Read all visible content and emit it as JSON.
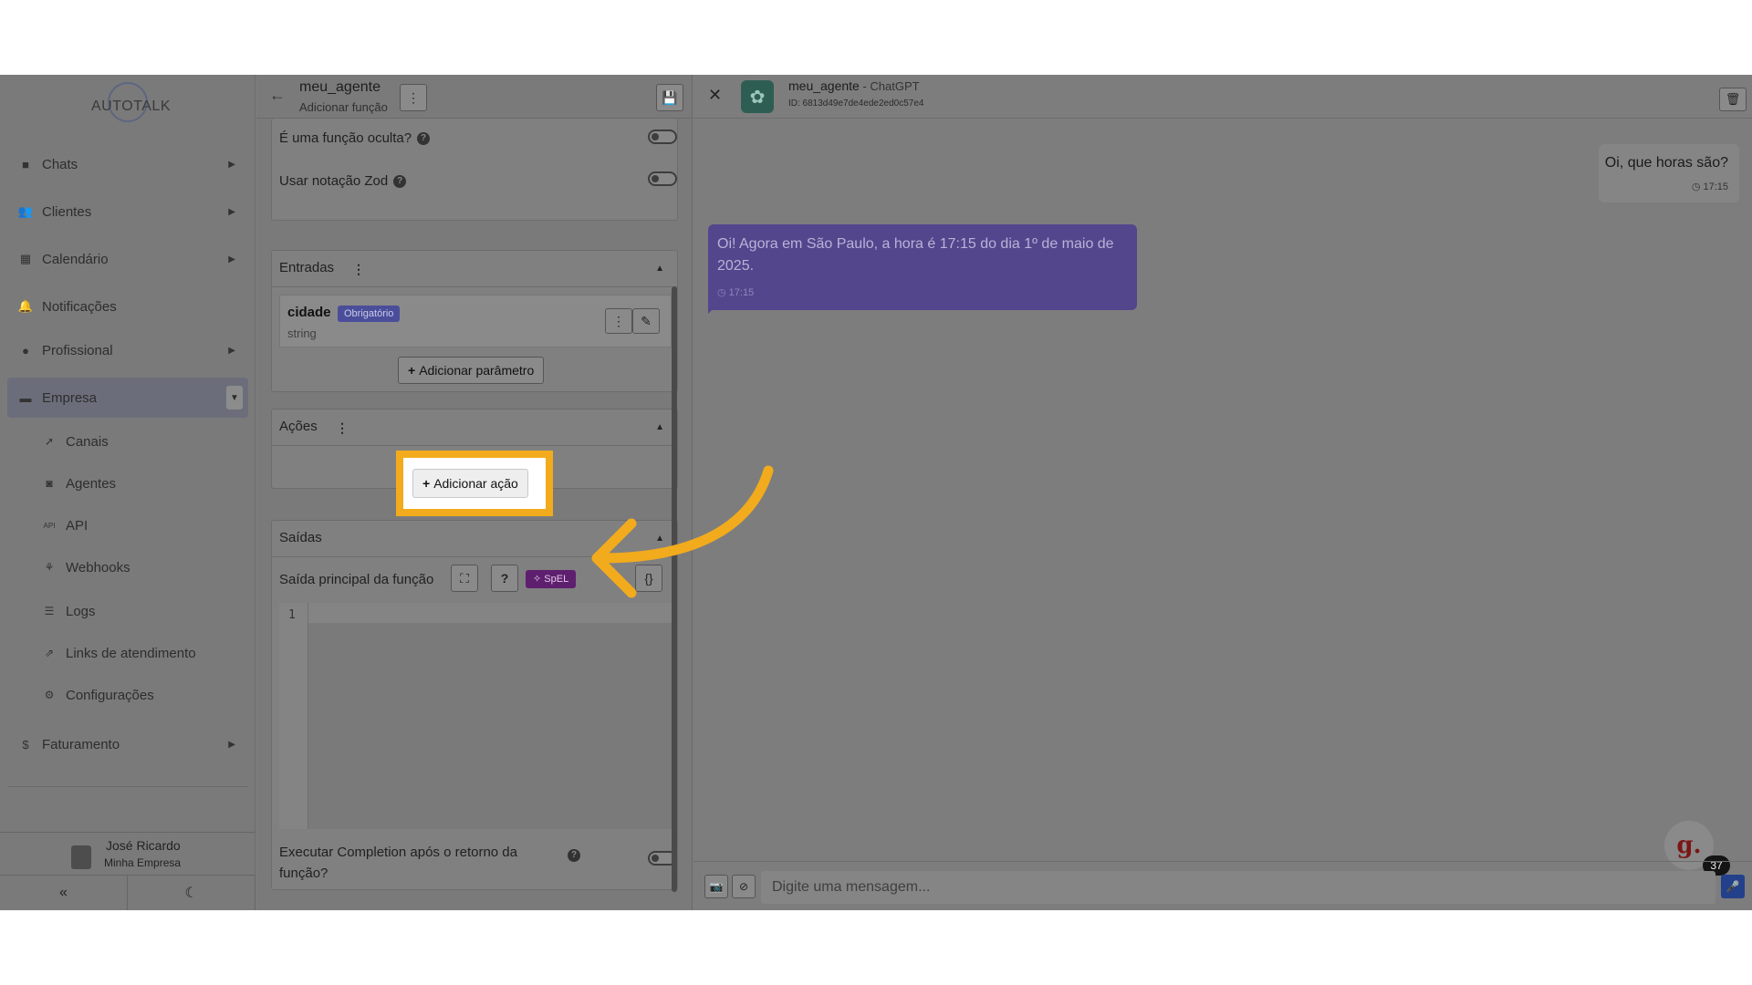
{
  "sidebar": {
    "logo": "AUTOTALK",
    "nav": [
      {
        "label": "Chats",
        "icon": "chat-icon"
      },
      {
        "label": "Clientes",
        "icon": "users-icon"
      },
      {
        "label": "Calendário",
        "icon": "calendar-icon"
      },
      {
        "label": "Notificações",
        "icon": "bell-icon"
      },
      {
        "label": "Profissional",
        "icon": "user-tie-icon"
      },
      {
        "label": "Empresa",
        "icon": "building-icon"
      }
    ],
    "sub": [
      {
        "label": "Canais",
        "icon": "rocket-icon"
      },
      {
        "label": "Agentes",
        "icon": "robot-icon"
      },
      {
        "label": "API",
        "icon": "api-icon"
      },
      {
        "label": "Webhooks",
        "icon": "webhook-icon"
      },
      {
        "label": "Logs",
        "icon": "list-icon"
      },
      {
        "label": "Links de atendimento",
        "icon": "external-link-icon"
      },
      {
        "label": "Configurações",
        "icon": "gear-icon"
      }
    ],
    "billing": {
      "label": "Faturamento",
      "icon": "dollar-icon"
    },
    "user": {
      "name": "José Ricardo",
      "company": "Minha Empresa"
    }
  },
  "editor": {
    "title": "meu_agente",
    "subtitle": "Adicionar função",
    "hidden_label": "É uma função oculta?",
    "zod_label": "Usar notação Zod",
    "inputs": {
      "title": "Entradas",
      "param": {
        "name": "cidade",
        "badge": "Obrigatório",
        "type": "string"
      },
      "add_param": "Adicionar parâmetro"
    },
    "actions": {
      "title": "Ações",
      "add_action": "Adicionar ação"
    },
    "outputs": {
      "title": "Saídas",
      "main_label": "Saída principal da função",
      "spel": "SpEL",
      "line_number": "1",
      "completion_label_1": "Executar Completion após o retorno da",
      "completion_label_2": "função?"
    }
  },
  "chat": {
    "agent_name": "meu_agente",
    "model": "ChatGPT",
    "agent_id": "ID: 6813d49e7de4ede2ed0c57e4",
    "messages": [
      {
        "from": "user",
        "text": "Oi, que horas são?",
        "time": "17:15"
      },
      {
        "from": "bot",
        "text": "Oi! Agora em São Paulo, a hora é 17:15 do dia 1º de maio de 2025.",
        "time": "17:15"
      }
    ],
    "input_placeholder": "Digite uma mensagem...",
    "badge_count": "37",
    "badge_letter": "g."
  },
  "colors": {
    "highlight": "#f2ab1c",
    "bot_bubble": "#53468d",
    "badge": "#4a4e9a",
    "spel": "#5e1f6e"
  }
}
